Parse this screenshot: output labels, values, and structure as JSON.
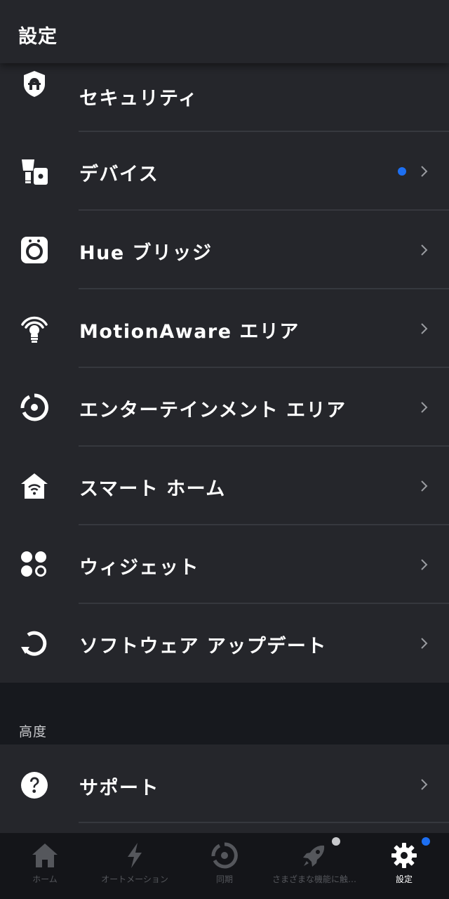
{
  "header": {
    "title": "設定"
  },
  "colors": {
    "background": "#17191e",
    "panel": "#25262b",
    "separator": "#36383e",
    "accent_blue": "#1d6ff2",
    "tab_inactive": "#55575c",
    "badge_gray": "#c8c9cc"
  },
  "settings": {
    "items": [
      {
        "label": "セキュリティ",
        "icon": "shield-icon",
        "chevron": false,
        "dot": false
      },
      {
        "label": "デバイス",
        "icon": "lamp-icon",
        "chevron": true,
        "dot": true
      },
      {
        "label": "Hue ブリッジ",
        "icon": "bridge-icon",
        "chevron": true,
        "dot": false
      },
      {
        "label": "MotionAware エリア",
        "icon": "motion-bulb-icon",
        "chevron": true,
        "dot": false
      },
      {
        "label": "エンターテインメント エリア",
        "icon": "entertainment-icon",
        "chevron": true,
        "dot": false
      },
      {
        "label": "スマート ホーム",
        "icon": "smart-home-icon",
        "chevron": true,
        "dot": false
      },
      {
        "label": "ウィジェット",
        "icon": "widgets-icon",
        "chevron": true,
        "dot": false
      },
      {
        "label": "ソフトウェア アップデート",
        "icon": "update-icon",
        "chevron": true,
        "dot": false
      }
    ]
  },
  "advanced": {
    "title": "高度",
    "items": [
      {
        "label": "サポート",
        "icon": "help-icon",
        "chevron": true
      }
    ]
  },
  "tabbar": {
    "tabs": [
      {
        "label": "ホーム",
        "icon": "home-icon",
        "active": false
      },
      {
        "label": "オートメーション",
        "icon": "lightning-icon",
        "active": false
      },
      {
        "label": "同期",
        "icon": "sync-icon",
        "active": false
      },
      {
        "label": "さまざまな機能に触…",
        "icon": "rocket-icon",
        "active": false,
        "badge": "gray"
      },
      {
        "label": "設定",
        "icon": "gear-icon",
        "active": true,
        "badge": "blue"
      }
    ]
  }
}
